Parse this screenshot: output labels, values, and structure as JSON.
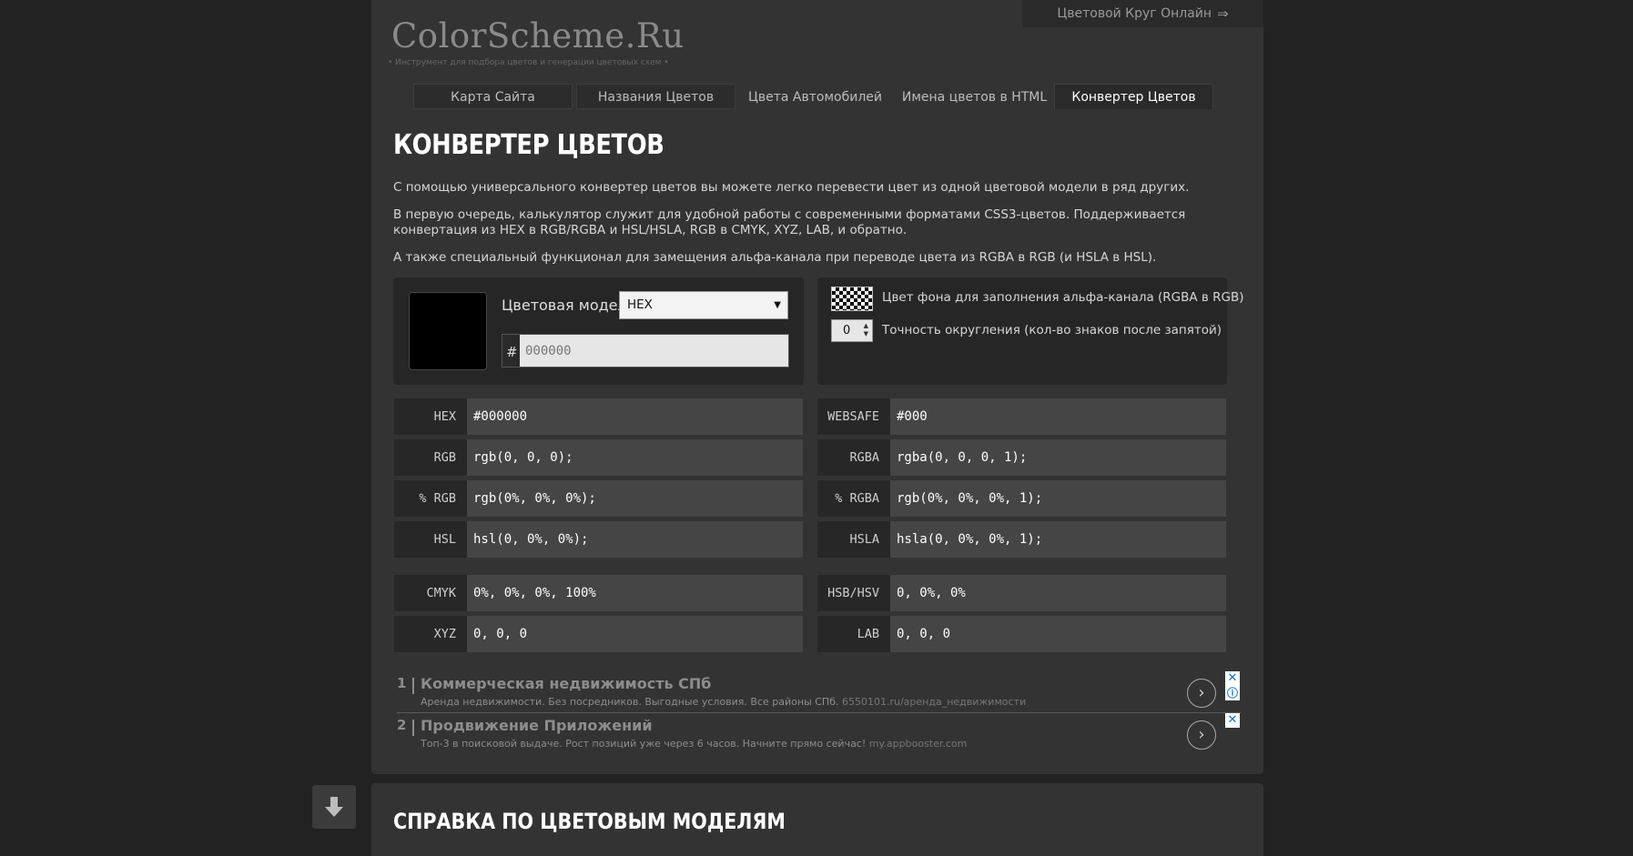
{
  "top_link": {
    "label": "Цветовой Круг Онлайн",
    "icon": "arrow-right-icon"
  },
  "logo": {
    "title": "ColorScheme.Ru",
    "tagline": "• Инструмент для подбора цветов и генерации цветовых схем •"
  },
  "nav": [
    {
      "label": "Карта Сайта",
      "state": "tab"
    },
    {
      "label": "Названия Цветов",
      "state": "plain"
    },
    {
      "label": "Цвета Автомобилей",
      "state": "plain"
    },
    {
      "label": "Имена цветов в HTML",
      "state": "plain"
    },
    {
      "label": "Конвертер Цветов",
      "state": "active"
    }
  ],
  "page": {
    "title": "КОНВЕРТЕР ЦВЕТОВ",
    "intro": [
      "С помощью универсального конвертер цветов вы можете легко перевести цвет из одной цветовой модели в ряд других.",
      "В первую очередь, калькулятор служит для удобной работы с современными форматами CSS3-цветов. Поддерживается конвертация из HEX в RGB/RGBA и HSL/HSLA, RGB в CMYK, XYZ, LAB, и обратно.",
      "А также специальный функционал для замещения альфа-канала при переводе цвета из RGBA в RGB (и HSLA в HSL)."
    ]
  },
  "converter": {
    "swatch_color": "#000000",
    "model_label": "Цветовая модель:",
    "model_selected": "HEX",
    "hash": "#",
    "input_value": "000000",
    "alpha_bg_label": "Цвет фона для заполнения альфа-канала (RGBA в RGB)",
    "precision_value": "0",
    "precision_label": "Точность округления (кол-во знаков после запятой)"
  },
  "results_left": [
    {
      "label": "HEX",
      "value": "#000000"
    },
    {
      "label": "RGB",
      "value": "rgb(0, 0, 0);"
    },
    {
      "label": "% RGB",
      "value": "rgb(0%, 0%, 0%);"
    },
    {
      "label": "HSL",
      "value": "hsl(0, 0%, 0%);"
    },
    {
      "label": "CMYK",
      "value": "0%, 0%, 0%, 100%"
    },
    {
      "label": "XYZ",
      "value": "0, 0, 0"
    }
  ],
  "results_right": [
    {
      "label": "WEBSAFE",
      "value": "#000"
    },
    {
      "label": "RGBA",
      "value": "rgba(0, 0, 0, 1);"
    },
    {
      "label": "% RGBA",
      "value": "rgb(0%, 0%, 0%, 1);"
    },
    {
      "label": "HSLA",
      "value": "hsla(0, 0%, 0%, 1);"
    },
    {
      "label": "HSB/HSV",
      "value": "0, 0%, 0%"
    },
    {
      "label": "LAB",
      "value": "0, 0, 0"
    }
  ],
  "ads": [
    {
      "num": "1",
      "title": "Коммерческая недвижимость СПб",
      "desc": "Аренда недвижимости. Без посредников. Выгодные условия. Все районы СПб.",
      "url": "6550101.ru/аренда_недвижимости"
    },
    {
      "num": "2",
      "title": "Продвижение Приложений",
      "desc": "Топ-3 в поисковой выдаче. Рост позиций уже через 6 часов. Начните прямо сейчас!",
      "url": "my.appbooster.com"
    }
  ],
  "ad_close": "✕",
  "ad_info": "ⓘ",
  "ad_go": "›",
  "section2": {
    "title": "СПРАВКА ПО ЦВЕТОВЫМ МОДЕЛЯМ"
  },
  "colors": {
    "page_bg": "#222222",
    "panel_bg": "#333333",
    "value_bg": "#454545",
    "label_bg": "#272727"
  }
}
